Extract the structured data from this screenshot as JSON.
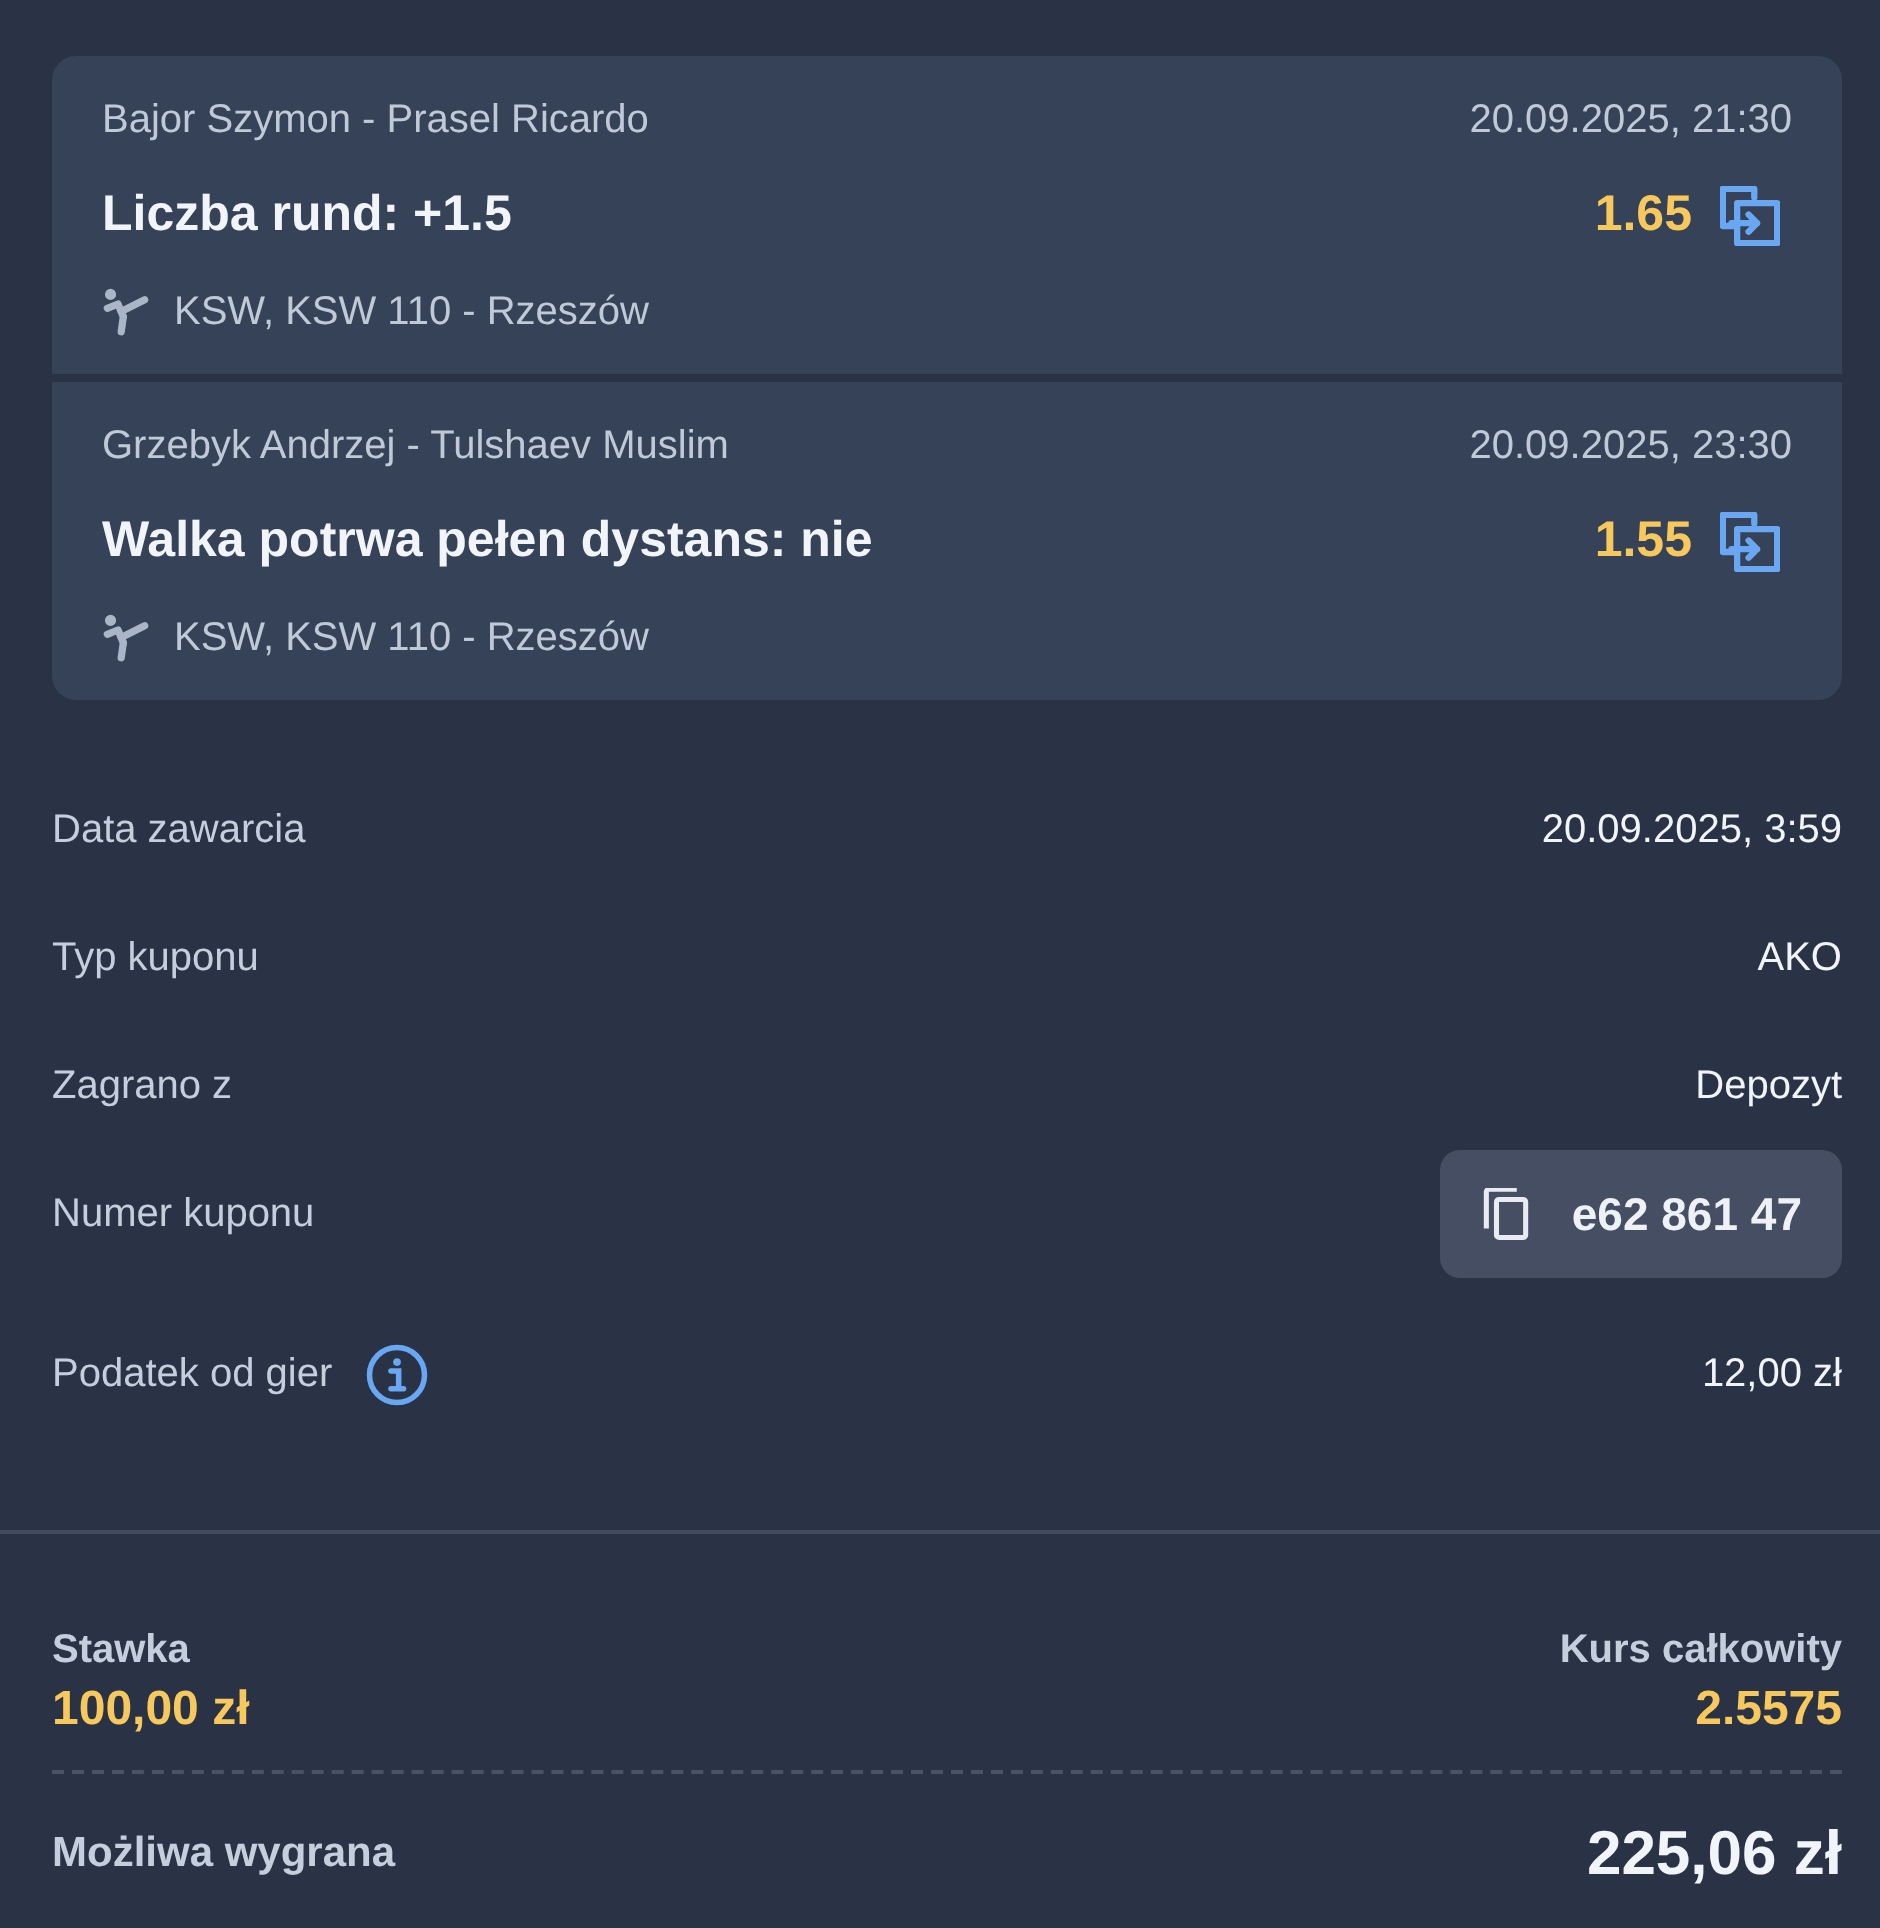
{
  "selections": [
    {
      "match": "Bajor Szymon - Prasel Ricardo",
      "datetime": "20.09.2025, 21:30",
      "bet": "Liczba rund: +1.5",
      "odds": "1.65",
      "league": "KSW, KSW 110 - Rzeszów"
    },
    {
      "match": "Grzebyk Andrzej - Tulshaev Muslim",
      "datetime": "20.09.2025, 23:30",
      "bet": "Walka potrwa pełen dystans: nie",
      "odds": "1.55",
      "league": "KSW, KSW 110 - Rzeszów"
    }
  ],
  "details": [
    {
      "kind": "text",
      "label": "Data zawarcia",
      "value": "20.09.2025, 3:59"
    },
    {
      "kind": "text",
      "label": "Typ kuponu",
      "value": "AKO"
    },
    {
      "kind": "text",
      "label": "Zagrano z",
      "value": "Depozyt"
    },
    {
      "kind": "copy",
      "label": "Numer kuponu",
      "value": "e62 861 47"
    },
    {
      "kind": "info",
      "label": "Podatek od gier",
      "value": "12,00 zł"
    }
  ],
  "summary": {
    "stake": {
      "label": "Stawka",
      "value": "100,00 zł"
    },
    "total_odds": {
      "label": "Kurs całkowity",
      "value": "2.5575"
    },
    "possible_win": {
      "label": "Możliwa wygrana",
      "value": "225,06 zł"
    }
  }
}
